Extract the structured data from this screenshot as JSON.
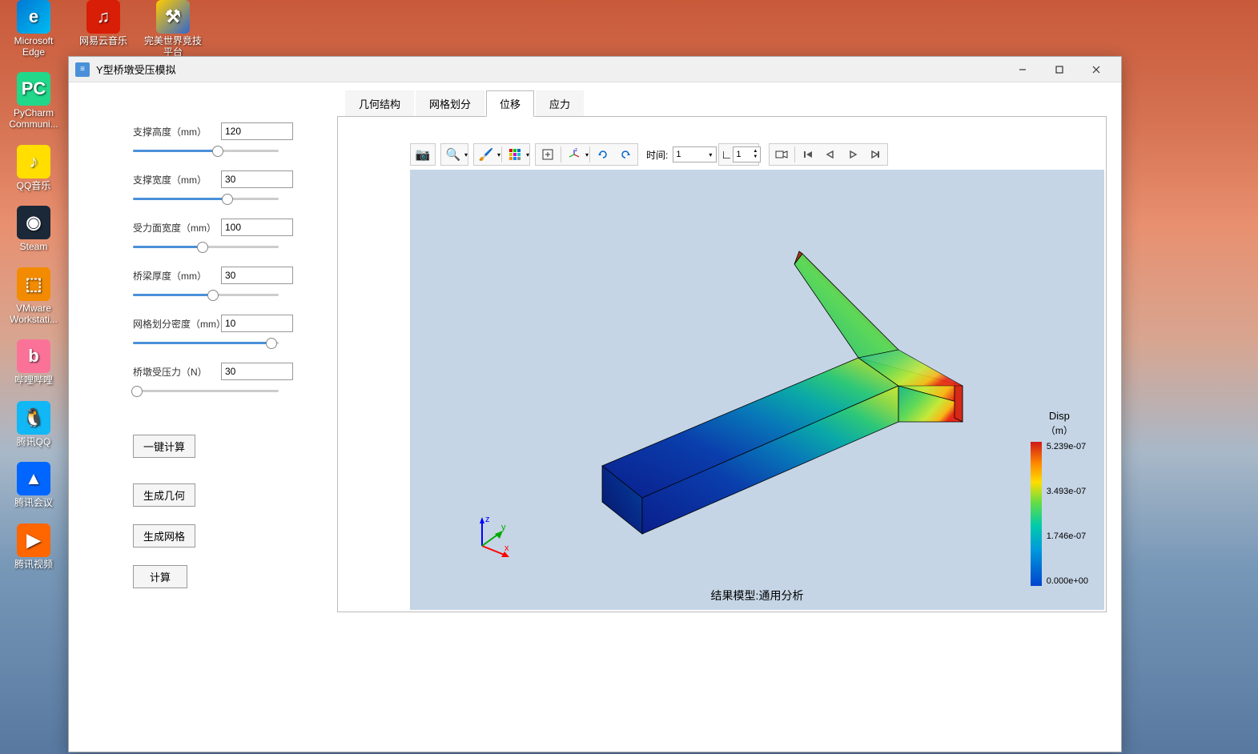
{
  "desktop_icons": [
    {
      "label": "Microsoft Edge",
      "bg": "linear-gradient(135deg,#0078d4,#00bcf2)",
      "glyph": "e"
    },
    {
      "label": "网易云音乐",
      "bg": "#d81e06",
      "glyph": "♫"
    },
    {
      "label": "完美世界竞技平台",
      "bg": "linear-gradient(135deg,#ffcc00,#3366cc)",
      "glyph": "⚒"
    },
    {
      "label": "PyCharm Communi...",
      "bg": "#21d789",
      "glyph": "PC"
    },
    {
      "label": "QQ音乐",
      "bg": "#ffde00",
      "glyph": "♪"
    },
    {
      "label": "Steam",
      "bg": "#1b2838",
      "glyph": "◉"
    },
    {
      "label": "VMware Workstati...",
      "bg": "#f38b00",
      "glyph": "⬚"
    },
    {
      "label": "哔哩哔哩",
      "bg": "#fb7299",
      "glyph": "b"
    },
    {
      "label": "腾讯QQ",
      "bg": "#12b7f5",
      "glyph": "🐧"
    },
    {
      "label": "腾讯会议",
      "bg": "#0066ff",
      "glyph": "▲"
    },
    {
      "label": "腾讯视频",
      "bg": "#ff6600",
      "glyph": "▶"
    }
  ],
  "window": {
    "title": "Y型桥墩受压模拟"
  },
  "params": [
    {
      "label": "支撑高度（mm）",
      "value": "120",
      "fill": "58%"
    },
    {
      "label": "支撑宽度（mm）",
      "value": "30",
      "fill": "65%"
    },
    {
      "label": "受力面宽度（mm）",
      "value": "100",
      "fill": "48%"
    },
    {
      "label": "桥梁厚度（mm）",
      "value": "30",
      "fill": "55%"
    },
    {
      "label": "网格划分密度（mm）",
      "value": "10",
      "fill": "95%"
    },
    {
      "label": "桥墩受压力（N）",
      "value": "30",
      "fill": "3%"
    }
  ],
  "buttons": {
    "calc_all": "一键计算",
    "gen_geom": "生成几何",
    "gen_mesh": "生成网格",
    "compute": "计算"
  },
  "tabs": [
    {
      "label": "几何结构",
      "active": false
    },
    {
      "label": "网格划分",
      "active": false
    },
    {
      "label": "位移",
      "active": true
    },
    {
      "label": "应力",
      "active": false
    }
  ],
  "toolbar": {
    "time_label": "时间:",
    "time_value": "1",
    "step_value": "1"
  },
  "legend": {
    "title": "Disp",
    "unit": "（m）",
    "ticks": [
      "5.239e-07",
      "3.493e-07",
      "1.746e-07",
      "0.000e+00"
    ]
  },
  "result_label": "结果模型:通用分析",
  "axes": {
    "x": "x",
    "y": "y",
    "z": "z"
  }
}
